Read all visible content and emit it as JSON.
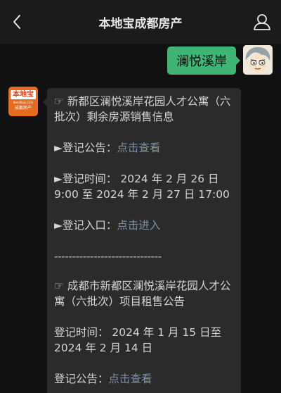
{
  "header": {
    "title": "本地宝成都房产"
  },
  "conversation": {
    "outgoing": {
      "text": "澜悦溪岸"
    },
    "incoming": {
      "avatar": {
        "brand": "本地宝",
        "url": "Bendibao.com",
        "sub": "成都房产",
        "bg_color": "#e66b1e"
      },
      "block1": {
        "title": "☞ 新都区澜悦溪岸花园人才公寓（六批次）剩余房源销售信息",
        "notice_label": "►登记公告：",
        "notice_link": "点击查看",
        "time_line1": "►登记时间： 2024 年 2 月 26 日",
        "time_line2": "9:00 至 2024 年 2 月 27 日 17:00",
        "entry_label": "►登记入口：",
        "entry_link": "点击进入"
      },
      "divider": "------------------------------",
      "block2": {
        "title": "☞ 成都市新都区澜悦溪岸花园人才公寓（六批次）项目租售公告",
        "time_line1": "登记时间： 2024 年 1 月 15 日至",
        "time_line2": "2024 年 2 月 14 日",
        "notice_label": "登记公告：",
        "notice_link": "点击查看"
      }
    }
  },
  "colors": {
    "background": "#111111",
    "navbar": "#1b1b1b",
    "outgoing_bubble": "#3eb575",
    "incoming_bubble": "#2b2b2b",
    "link": "#7d90a9"
  },
  "icons": {
    "back": "chevron-left-icon",
    "profile": "person-icon"
  }
}
